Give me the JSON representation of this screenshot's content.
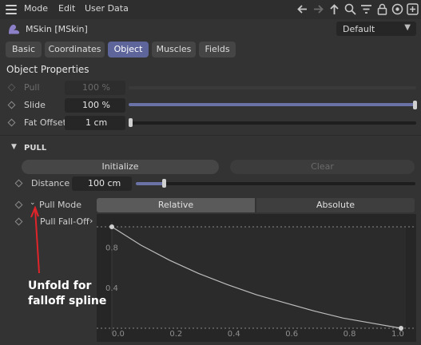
{
  "menu": [
    "Mode",
    "Edit",
    "User Data"
  ],
  "toolbar_icons": [
    "arrow-left-icon",
    "arrow-right-icon",
    "arrow-up-icon",
    "search-icon",
    "filter-icon",
    "lock-icon",
    "target-icon",
    "add-icon"
  ],
  "header": {
    "title": "MSkin [MSkin]",
    "preset": "Default"
  },
  "tabs": [
    {
      "label": "Basic",
      "active": false
    },
    {
      "label": "Coordinates",
      "active": false
    },
    {
      "label": "Object",
      "active": true
    },
    {
      "label": "Muscles",
      "active": false
    },
    {
      "label": "Fields",
      "active": false
    }
  ],
  "object_properties": {
    "title": "Object Properties",
    "pull": {
      "label": "Pull",
      "value": "100 %",
      "enabled": false
    },
    "slide": {
      "label": "Slide",
      "value": "100 %",
      "level": 1.0
    },
    "fat_offset": {
      "label": "Fat Offset",
      "value": "1 cm",
      "level": 0.0
    }
  },
  "pull_section": {
    "title": "PULL",
    "initialize_label": "Initialize",
    "clear_label": "Clear",
    "distance": {
      "label": "Distance",
      "value": "100 cm",
      "level": 0.1
    },
    "pull_mode": {
      "label": "Pull Mode",
      "options": [
        "Relative",
        "Absolute"
      ],
      "selected": "Relative"
    },
    "falloff_label": "Pull Fall-Off"
  },
  "chart_data": {
    "type": "line",
    "x_ticks": [
      "0.0",
      "0.2",
      "0.4",
      "0.6",
      "0.8",
      "1.0"
    ],
    "y_ticks": [
      "0.8",
      "0.4"
    ],
    "xlim": [
      0,
      1
    ],
    "ylim": [
      0,
      1
    ],
    "series": [
      {
        "x": [
          0,
          0.1,
          0.2,
          0.3,
          0.4,
          0.5,
          0.6,
          0.7,
          0.8,
          0.9,
          1.0
        ],
        "y": [
          1.0,
          0.82,
          0.67,
          0.54,
          0.43,
          0.33,
          0.25,
          0.17,
          0.1,
          0.05,
          0.0
        ]
      }
    ],
    "control_points": [
      {
        "x": 0,
        "y": 1.0
      },
      {
        "x": 1.0,
        "y": 0.0
      }
    ]
  },
  "annotation": {
    "line1": "Unfold for",
    "line2": "falloff spline",
    "color": "#e0242a"
  }
}
